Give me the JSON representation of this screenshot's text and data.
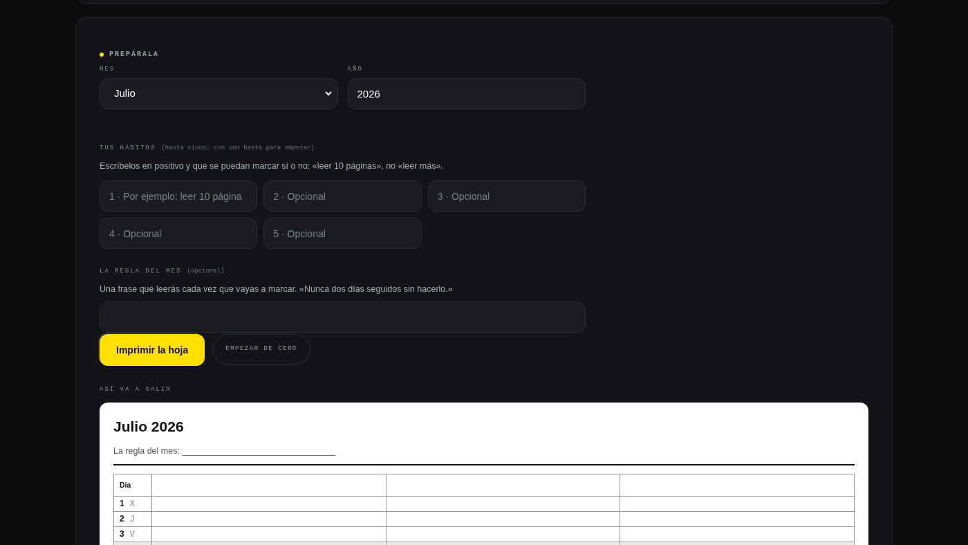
{
  "section": {
    "title": "PREPÁRALA"
  },
  "month_field": {
    "label": "MES",
    "value": "Julio"
  },
  "year_field": {
    "label": "AÑO",
    "value": "2026"
  },
  "habits": {
    "label": "TUS HÁBITOS",
    "note": "(hasta cinco; con uno basta para empezar)",
    "help": "Escríbelos en positivo y que se puedan marcar sí o no: «leer 10 páginas», no «leer más».",
    "inputs": [
      {
        "placeholder": "1 · Por ejemplo: leer 10 página"
      },
      {
        "placeholder": "2 · Opcional"
      },
      {
        "placeholder": "3 · Opcional"
      },
      {
        "placeholder": "4 · Opcional"
      },
      {
        "placeholder": "5 · Opcional"
      }
    ]
  },
  "rule": {
    "label": "LA REGLA DEL MES",
    "note": "(opcional)",
    "help": "Una frase que leerás cada vez que vayas a marcar. «Nunca dos días seguidos sin hacerlo.»"
  },
  "buttons": {
    "print": "Imprimir la hoja",
    "reset": "EMPEZAR DE CERO"
  },
  "preview": {
    "label": "ASÍ VA A SALIR",
    "title": "Julio 2026",
    "rule_line": "La regla del mes: ________________________________",
    "columns": [
      "Día"
    ],
    "rows": [
      {
        "day": "1",
        "weekday": "X",
        "weekend": false
      },
      {
        "day": "2",
        "weekday": "J",
        "weekend": false
      },
      {
        "day": "3",
        "weekday": "V",
        "weekend": false
      },
      {
        "weekend": true
      }
    ]
  }
}
